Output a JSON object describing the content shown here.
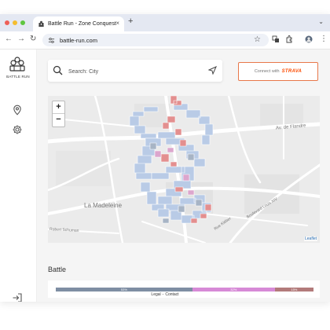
{
  "browser": {
    "tab_title": "Battle Run - Zone Conquest",
    "new_tab": "+",
    "tab_close": "×",
    "url": "battle-run.com",
    "traffic_lights": [
      "#ee5f57",
      "#f5bd2f",
      "#5fc640"
    ]
  },
  "sidebar": {
    "logo_text": "BATTLE RUN",
    "icons": [
      "location-pin-icon",
      "settings-gear-icon",
      "logout-icon"
    ]
  },
  "search": {
    "placeholder": "Search: City"
  },
  "strava": {
    "prefix": "Connect with",
    "brand": "STRAVA",
    "color": "#fc4c02"
  },
  "map": {
    "zoom_in": "+",
    "zoom_out": "−",
    "labels": [
      "Av. de Flandre",
      "La Madeleine",
      "Robert Schuman",
      "Rue Kléber",
      "Boulevard Louis XIV"
    ],
    "attribution": "Leaflet",
    "colors": {
      "zone_blue": "#b4c8e6",
      "zone_red": "#e48a8a",
      "zone_pink": "#dba2cc",
      "zone_gray": "#a9b6c6"
    }
  },
  "battle": {
    "title": "Battle",
    "segments": [
      {
        "label": "53%",
        "value": 53,
        "color": "#7e8ea3"
      },
      {
        "label": "32%",
        "value": 32,
        "color": "#d68ad6"
      },
      {
        "label": "15%",
        "value": 15,
        "color": "#b27b7b"
      }
    ]
  },
  "footer": {
    "legal": "Legal",
    "separator": "-",
    "contact": "Contact"
  }
}
